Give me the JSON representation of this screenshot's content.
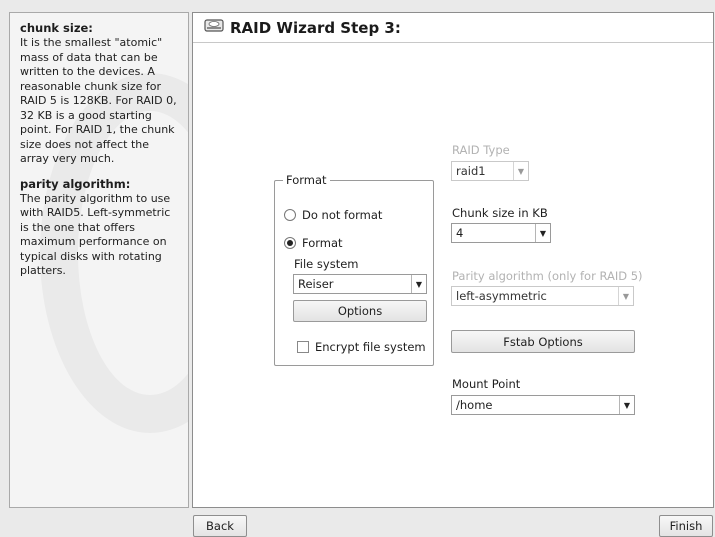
{
  "help": {
    "sections": [
      {
        "heading": "chunk size:",
        "text": "It is the smallest \"atomic\" mass of data that can be written to the devices. A reasonable chunk size for RAID 5 is 128KB. For RAID 0, 32 KB is a good starting point. For RAID 1, the chunk size does not affect the array very much."
      },
      {
        "heading": "parity algorithm:",
        "text": "The parity algorithm to use with RAID5. Left-symmetric is the one that offers maximum performance on typical disks with rotating platters."
      }
    ]
  },
  "wizard": {
    "title": "RAID Wizard Step 3:",
    "title_icon": "harddisk-icon"
  },
  "format_group": {
    "legend": "Format",
    "do_not_format_label": "Do not format",
    "format_label": "Format",
    "selected": "Format",
    "file_system_label": "File system",
    "file_system_value": "Reiser",
    "options_button": "Options",
    "encrypt_label": "Encrypt file system",
    "encrypt_checked": false
  },
  "raid_settings": {
    "raid_type_label": "RAID Type",
    "raid_type_value": "raid1",
    "chunk_size_label": "Chunk size in KB",
    "chunk_size_value": "4",
    "parity_label": "Parity algorithm (only for RAID 5)",
    "parity_value": "left-asymmetric",
    "fstab_button": "Fstab Options",
    "mount_point_label": "Mount Point",
    "mount_point_value": "/home"
  },
  "footer": {
    "back_label": "Back",
    "finish_label": "Finish"
  },
  "icons": {
    "dropdown_arrow": "chevron-down-icon"
  }
}
